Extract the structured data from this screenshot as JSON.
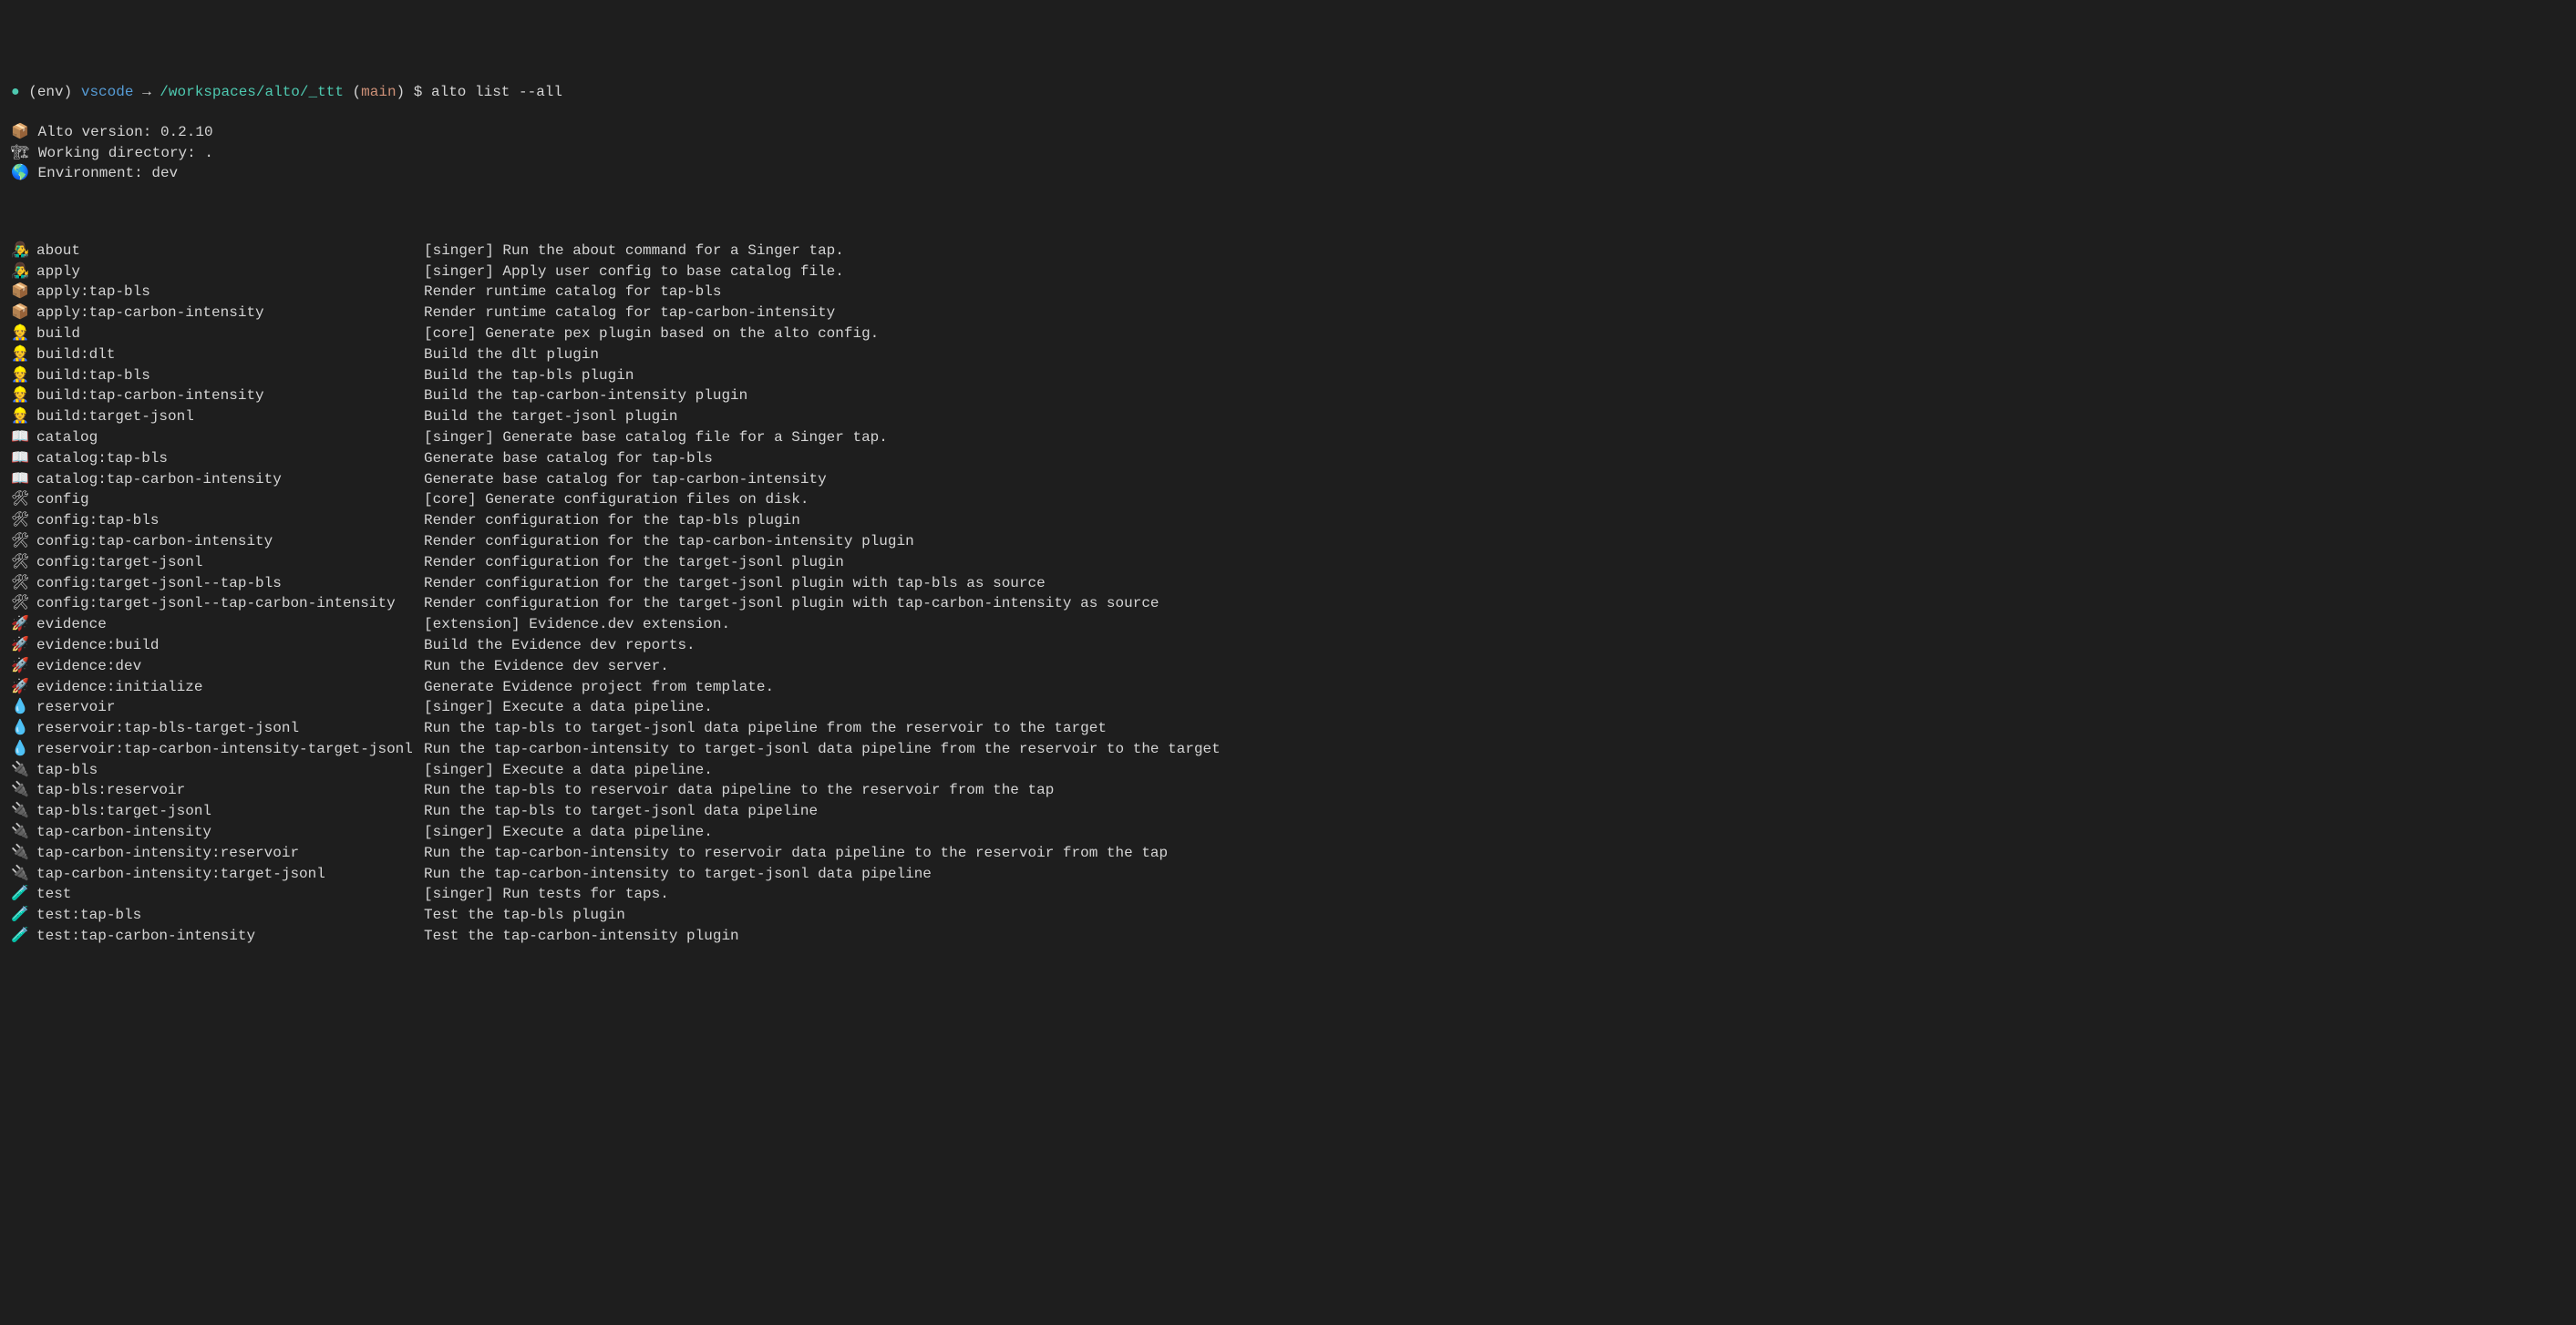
{
  "prompt": {
    "bullet": "●",
    "env": "(env)",
    "host": "vscode",
    "arrow": "→",
    "path": "/workspaces/alto/_ttt",
    "branch_open": "(",
    "branch": "main",
    "branch_close": ")",
    "dollar": "$",
    "command": "alto list --all"
  },
  "header": [
    {
      "emoji": "📦",
      "text": "Alto version: 0.2.10"
    },
    {
      "emoji": "🏗",
      "text": "Working directory: ."
    },
    {
      "emoji": "🌎",
      "text": "Environment: dev"
    }
  ],
  "rows": [
    {
      "emoji": "👨‍🎤",
      "name": "about",
      "desc": "[singer] Run the about command for a Singer tap."
    },
    {
      "emoji": "👨‍🎤",
      "name": "apply",
      "desc": "[singer] Apply user config to base catalog file."
    },
    {
      "emoji": "📦",
      "name": "apply:tap-bls",
      "desc": "Render runtime catalog for tap-bls"
    },
    {
      "emoji": "📦",
      "name": "apply:tap-carbon-intensity",
      "desc": "Render runtime catalog for tap-carbon-intensity"
    },
    {
      "emoji": "👷",
      "name": "build",
      "desc": "[core] Generate pex plugin based on the alto config."
    },
    {
      "emoji": "👷",
      "name": "build:dlt",
      "desc": "Build the dlt plugin"
    },
    {
      "emoji": "👷",
      "name": "build:tap-bls",
      "desc": "Build the tap-bls plugin"
    },
    {
      "emoji": "👷",
      "name": "build:tap-carbon-intensity",
      "desc": "Build the tap-carbon-intensity plugin"
    },
    {
      "emoji": "👷",
      "name": "build:target-jsonl",
      "desc": "Build the target-jsonl plugin"
    },
    {
      "emoji": "📖",
      "name": "catalog",
      "desc": "[singer] Generate base catalog file for a Singer tap."
    },
    {
      "emoji": "📖",
      "name": "catalog:tap-bls",
      "desc": "Generate base catalog for tap-bls"
    },
    {
      "emoji": "📖",
      "name": "catalog:tap-carbon-intensity",
      "desc": "Generate base catalog for tap-carbon-intensity"
    },
    {
      "emoji": "🛠",
      "name": "config",
      "desc": "[core] Generate configuration files on disk."
    },
    {
      "emoji": "🛠",
      "name": "config:tap-bls",
      "desc": "Render configuration for the tap-bls plugin"
    },
    {
      "emoji": "🛠",
      "name": "config:tap-carbon-intensity",
      "desc": "Render configuration for the tap-carbon-intensity plugin"
    },
    {
      "emoji": "🛠",
      "name": "config:target-jsonl",
      "desc": "Render configuration for the target-jsonl plugin"
    },
    {
      "emoji": "🛠",
      "name": "config:target-jsonl--tap-bls",
      "desc": "Render configuration for the target-jsonl plugin with tap-bls as source"
    },
    {
      "emoji": "🛠",
      "name": "config:target-jsonl--tap-carbon-intensity",
      "desc": "Render configuration for the target-jsonl plugin with tap-carbon-intensity as source"
    },
    {
      "emoji": "🚀",
      "name": "evidence",
      "desc": "[extension] Evidence.dev extension."
    },
    {
      "emoji": "🚀",
      "name": "evidence:build",
      "desc": "Build the Evidence dev reports."
    },
    {
      "emoji": "🚀",
      "name": "evidence:dev",
      "desc": "Run the Evidence dev server."
    },
    {
      "emoji": "🚀",
      "name": "evidence:initialize",
      "desc": "Generate Evidence project from template."
    },
    {
      "emoji": "💧",
      "name": "reservoir",
      "desc": "[singer] Execute a data pipeline."
    },
    {
      "emoji": "💧",
      "name": "reservoir:tap-bls-target-jsonl",
      "desc": "Run the tap-bls to target-jsonl data pipeline from the reservoir to the target"
    },
    {
      "emoji": "💧",
      "name": "reservoir:tap-carbon-intensity-target-jsonl",
      "desc": "Run the tap-carbon-intensity to target-jsonl data pipeline from the reservoir to the target"
    },
    {
      "emoji": "🔌",
      "name": "tap-bls",
      "desc": "[singer] Execute a data pipeline."
    },
    {
      "emoji": "🔌",
      "name": "tap-bls:reservoir",
      "desc": "Run the tap-bls to reservoir data pipeline to the reservoir from the tap"
    },
    {
      "emoji": "🔌",
      "name": "tap-bls:target-jsonl",
      "desc": "Run the tap-bls to target-jsonl data pipeline"
    },
    {
      "emoji": "🔌",
      "name": "tap-carbon-intensity",
      "desc": "[singer] Execute a data pipeline."
    },
    {
      "emoji": "🔌",
      "name": "tap-carbon-intensity:reservoir",
      "desc": "Run the tap-carbon-intensity to reservoir data pipeline to the reservoir from the tap"
    },
    {
      "emoji": "🔌",
      "name": "tap-carbon-intensity:target-jsonl",
      "desc": "Run the tap-carbon-intensity to target-jsonl data pipeline"
    },
    {
      "emoji": "🧪",
      "name": "test",
      "desc": "[singer] Run tests for taps."
    },
    {
      "emoji": "🧪",
      "name": "test:tap-bls",
      "desc": "Test the tap-bls plugin"
    },
    {
      "emoji": "🧪",
      "name": "test:tap-carbon-intensity",
      "desc": "Test the tap-carbon-intensity plugin"
    }
  ]
}
